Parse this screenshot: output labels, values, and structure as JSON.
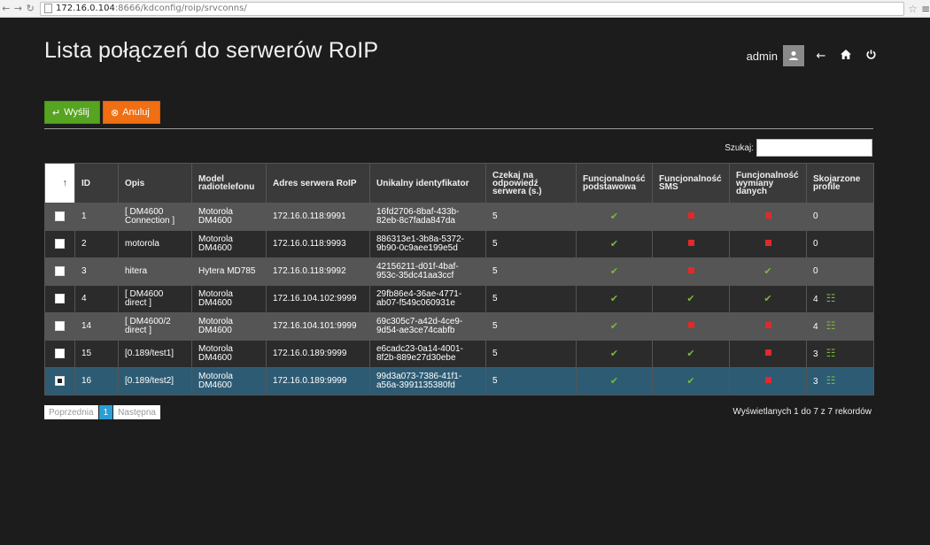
{
  "browser": {
    "url_host": "172.16.0.104",
    "url_rest": ":8666/kdconfig/roip/srvconns/"
  },
  "header": {
    "title": "Lista połączeń do serwerów RoIP",
    "username": "admin"
  },
  "toolbar": {
    "send_label": "Wyślij",
    "cancel_label": "Anuluj"
  },
  "search": {
    "label": "Szukaj:",
    "value": ""
  },
  "table": {
    "sort_indicator": "↑",
    "columns": [
      "ID",
      "Opis",
      "Model radiotelefonu",
      "Adres serwera RoIP",
      "Unikalny identyfikator",
      "Czekaj na odpowiedź serwera (s.)",
      "Funcjonalność podstawowa",
      "Funcjonalność SMS",
      "Funcjonalność wymiany danych",
      "Skojarzone profile"
    ],
    "rows": [
      {
        "checked": false,
        "id": "1",
        "opis": "[ DM4600 Connection ]",
        "model": "Motorola DM4600",
        "address": "172.16.0.118:9991",
        "uid": "16fd2706-8baf-433b-82eb-8c7fada847da",
        "wait": "5",
        "basic": true,
        "sms": false,
        "data": false,
        "profiles": "0",
        "has_list": false
      },
      {
        "checked": false,
        "id": "2",
        "opis": "motorola",
        "model": "Motorola DM4600",
        "address": "172.16.0.118:9993",
        "uid": "886313e1-3b8a-5372-9b90-0c9aee199e5d",
        "wait": "5",
        "basic": true,
        "sms": false,
        "data": false,
        "profiles": "0",
        "has_list": false
      },
      {
        "checked": false,
        "id": "3",
        "opis": "hitera",
        "model": "Hytera MD785",
        "address": "172.16.0.118:9992",
        "uid": "42156211-d01f-4baf-953c-35dc41aa3ccf",
        "wait": "5",
        "basic": true,
        "sms": false,
        "data": true,
        "profiles": "0",
        "has_list": false
      },
      {
        "checked": false,
        "id": "4",
        "opis": "[ DM4600 direct ]",
        "model": "Motorola DM4600",
        "address": "172.16.104.102:9999",
        "uid": "29fb86e4-36ae-4771-ab07-f549c060931e",
        "wait": "5",
        "basic": true,
        "sms": true,
        "data": true,
        "profiles": "4",
        "has_list": true
      },
      {
        "checked": false,
        "id": "14",
        "opis": "[ DM4600/2 direct ]",
        "model": "Motorola DM4600",
        "address": "172.16.104.101:9999",
        "uid": "69c305c7-a42d-4ce9-9d54-ae3ce74cabfb",
        "wait": "5",
        "basic": true,
        "sms": false,
        "data": false,
        "profiles": "4",
        "has_list": true
      },
      {
        "checked": false,
        "id": "15",
        "opis": "[0.189/test1]",
        "model": "Motorola DM4600",
        "address": "172.16.0.189:9999",
        "uid": "e6cadc23-0a14-4001-8f2b-889e27d30ebe",
        "wait": "5",
        "basic": true,
        "sms": true,
        "data": false,
        "profiles": "3",
        "has_list": true
      },
      {
        "checked": true,
        "id": "16",
        "opis": "[0.189/test2]",
        "model": "Motorola DM4600",
        "address": "172.16.0.189:9999",
        "uid": "99d3a073-7386-41f1-a56a-3991135380fd",
        "wait": "5",
        "basic": true,
        "sms": true,
        "data": false,
        "profiles": "3",
        "has_list": true
      }
    ]
  },
  "pagination": {
    "prev_label": "Poprzednia",
    "current_page": "1",
    "next_label": "Następna",
    "info": "Wyświetlanych 1 do 7 z 7 rekordów"
  },
  "colors": {
    "send": "#56a420",
    "cancel": "#f06f13",
    "ok": "#7ab83c",
    "no": "#e02a2a",
    "selected_row": "#2d5b73"
  }
}
